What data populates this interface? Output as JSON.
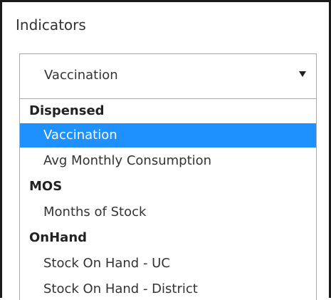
{
  "label": "Indicators",
  "select": {
    "value": "Vaccination",
    "arrow_icon": "triangle-down"
  },
  "dropdown": {
    "selected_color": "#1e90ff",
    "groups": [
      {
        "label": "Dispensed",
        "items": [
          "Vaccination",
          "Avg Monthly Consumption"
        ]
      },
      {
        "label": "MOS",
        "items": [
          "Months of Stock"
        ]
      },
      {
        "label": "OnHand",
        "items": [
          "Stock On Hand - UC",
          "Stock On Hand - District"
        ]
      }
    ]
  }
}
